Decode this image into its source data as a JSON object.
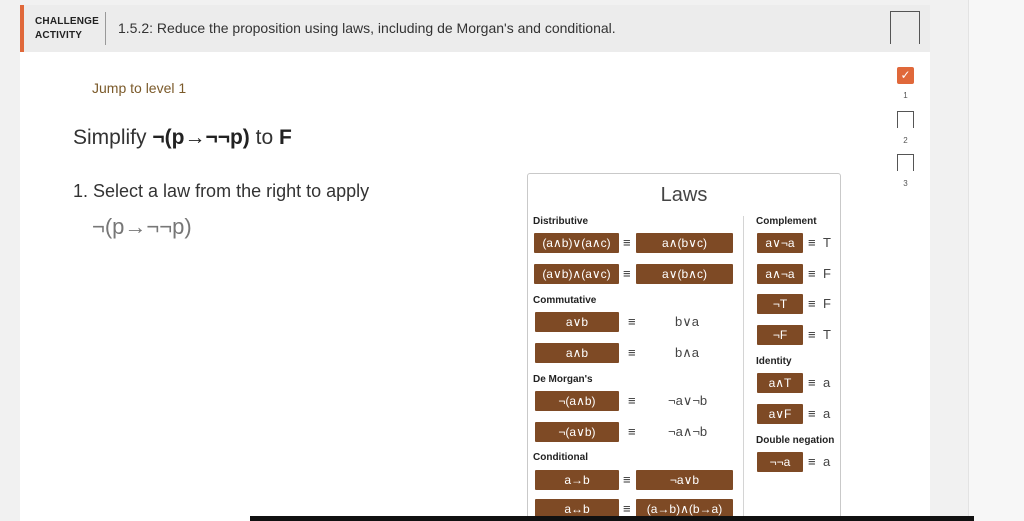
{
  "header": {
    "challenge_line1": "CHALLENGE",
    "challenge_line2": "ACTIVITY",
    "title": "1.5.2: Reduce the proposition using laws, including de Morgan's and conditional."
  },
  "main": {
    "jump_link": "Jump to level 1",
    "simplify_prefix": "Simplify ",
    "simplify_expr": "¬(p→¬¬p)",
    "simplify_to": " to ",
    "simplify_target": "F",
    "step_text": "1. Select a law from the right to apply",
    "current_expr": "¬(p→¬¬p)"
  },
  "laws": {
    "title": "Laws",
    "distributive": {
      "label": "Distributive",
      "rows": [
        {
          "left": "(a∧b)∨(a∧c)",
          "eq": "≡",
          "right": "a∧(b∨c)"
        },
        {
          "left": "(a∨b)∧(a∨c)",
          "eq": "≡",
          "right": "a∨(b∧c)"
        }
      ]
    },
    "commutative": {
      "label": "Commutative",
      "rows": [
        {
          "left": "a∨b",
          "eq": "≡",
          "right": "b∨a"
        },
        {
          "left": "a∧b",
          "eq": "≡",
          "right": "b∧a"
        }
      ]
    },
    "demorgan": {
      "label": "De Morgan's",
      "rows": [
        {
          "left": "¬(a∧b)",
          "eq": "≡",
          "right": "¬a∨¬b"
        },
        {
          "left": "¬(a∨b)",
          "eq": "≡",
          "right": "¬a∧¬b"
        }
      ]
    },
    "conditional": {
      "label": "Conditional",
      "rows": [
        {
          "left": "a→b",
          "eq": "≡",
          "right": "¬a∨b"
        },
        {
          "left": "a↔b",
          "eq": "≡",
          "right": "(a→b)∧(b→a)"
        }
      ]
    },
    "complement": {
      "label": "Complement",
      "rows": [
        {
          "left": "a∨¬a",
          "eq": "≡",
          "right": "T"
        },
        {
          "left": "a∧¬a",
          "eq": "≡",
          "right": "F"
        },
        {
          "left": "¬T",
          "eq": "≡",
          "right": "F"
        },
        {
          "left": "¬F",
          "eq": "≡",
          "right": "T"
        }
      ]
    },
    "identity": {
      "label": "Identity",
      "rows": [
        {
          "left": "a∧T",
          "eq": "≡",
          "right": "a"
        },
        {
          "left": "a∨F",
          "eq": "≡",
          "right": "a"
        }
      ]
    },
    "double_negation": {
      "label": "Double negation",
      "rows": [
        {
          "left": "¬¬a",
          "eq": "≡",
          "right": "a"
        }
      ]
    }
  },
  "levels": {
    "items": [
      {
        "number": "1",
        "status": "completed",
        "icon": "check-icon"
      },
      {
        "number": "2",
        "status": "incomplete",
        "icon": "level-box-icon"
      },
      {
        "number": "3",
        "status": "incomplete",
        "icon": "level-box-icon"
      }
    ]
  },
  "colors": {
    "accent": "#e0683a",
    "law_button": "#7e4a25",
    "link": "#7b5a2a"
  }
}
